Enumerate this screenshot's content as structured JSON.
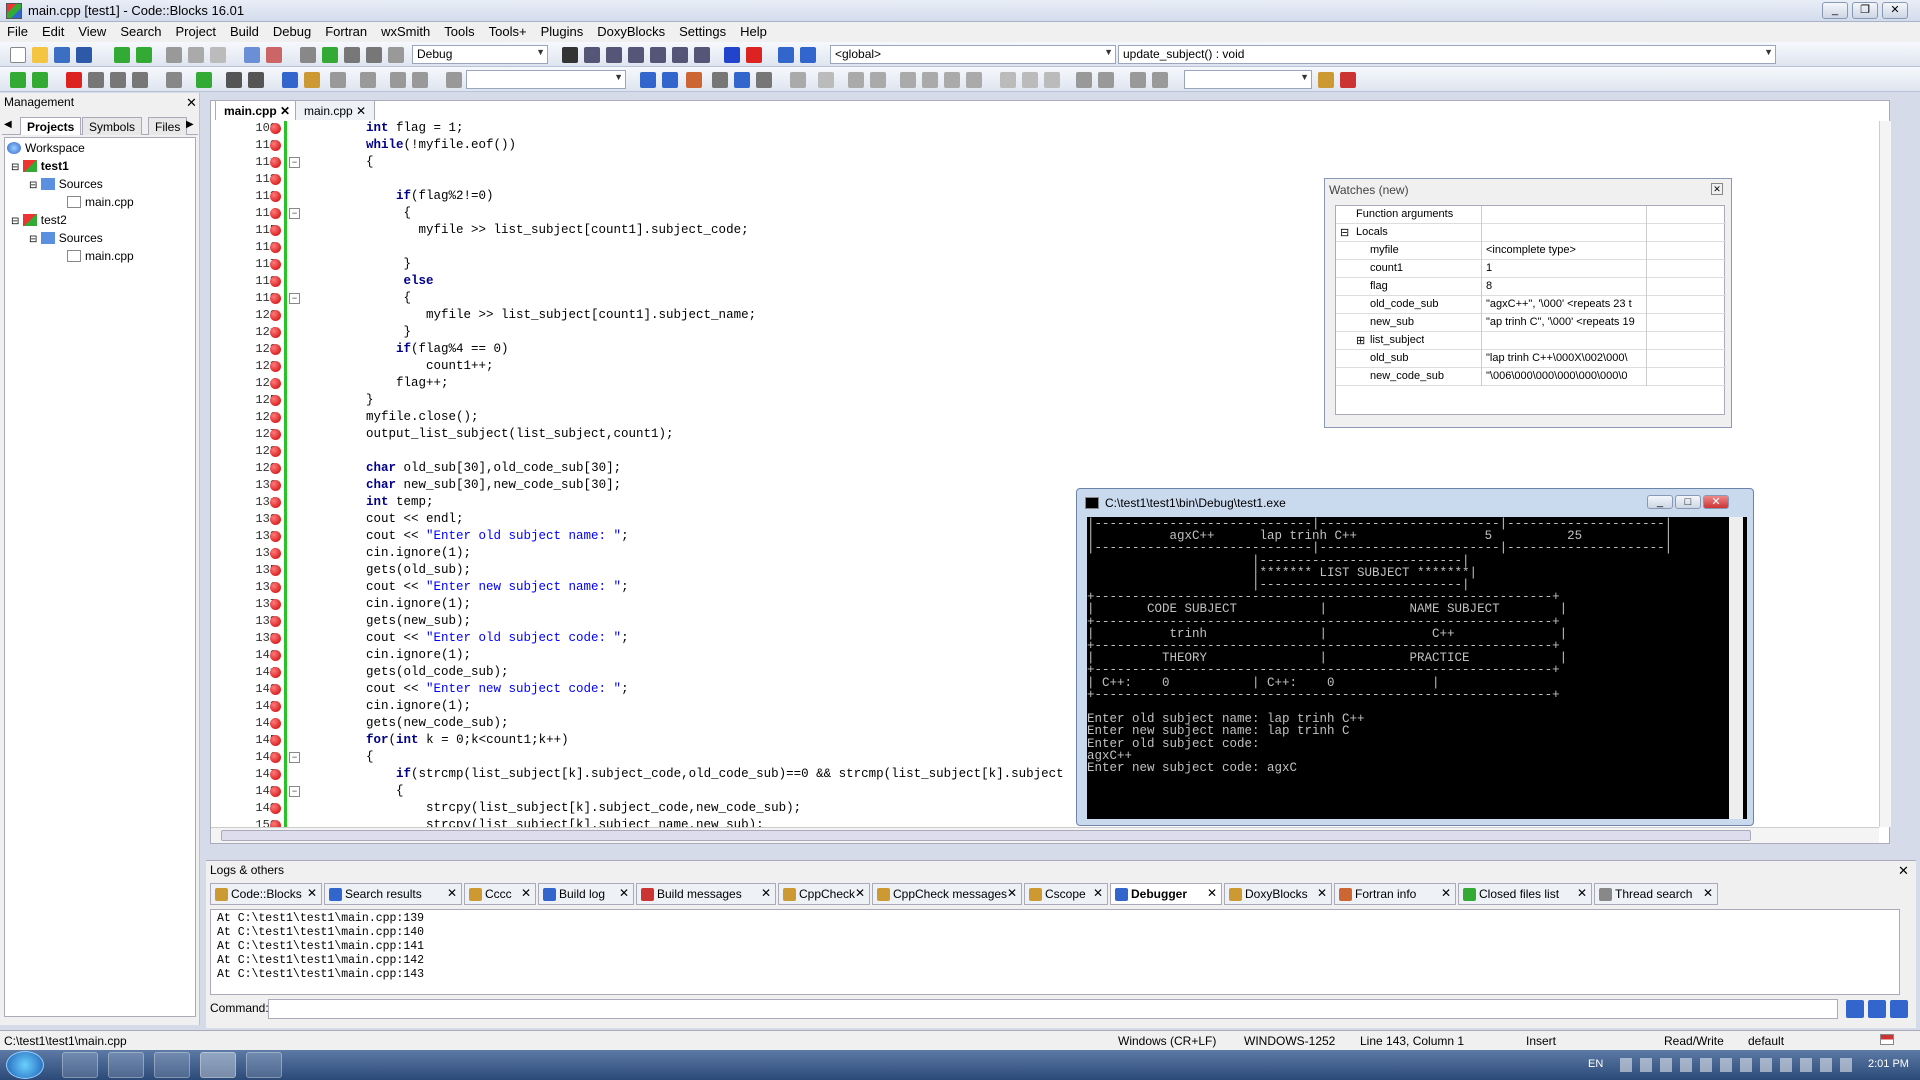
{
  "window": {
    "title": "main.cpp [test1] - Code::Blocks 16.01"
  },
  "menu": [
    "File",
    "Edit",
    "View",
    "Search",
    "Project",
    "Build",
    "Debug",
    "Fortran",
    "wxSmith",
    "Tools",
    "Tools+",
    "Plugins",
    "DoxyBlocks",
    "Settings",
    "Help"
  ],
  "toolbar": {
    "build_target": "Debug",
    "scope": "<global>",
    "function": "update_subject() : void"
  },
  "management": {
    "title": "Management",
    "tabs": [
      "Projects",
      "Symbols",
      "Files"
    ],
    "tree": {
      "workspace": "Workspace",
      "p1": "test1",
      "p1_sources": "Sources",
      "p1_file": "main.cpp",
      "p2": "test2",
      "p2_sources": "Sources",
      "p2_file": "main.cpp"
    }
  },
  "editor": {
    "tabs": [
      "main.cpp",
      "main.cpp"
    ]
  },
  "code": [
    {
      "n": "109",
      "t": "    int flag = 1;"
    },
    {
      "n": "110",
      "t": "    while(!myfile.eof())"
    },
    {
      "n": "111",
      "t": "    {"
    },
    {
      "n": "112",
      "t": ""
    },
    {
      "n": "113",
      "t": "        if(flag%2!=0)"
    },
    {
      "n": "114",
      "t": "         {"
    },
    {
      "n": "115",
      "t": "           myfile >> list_subject[count1].subject_code;"
    },
    {
      "n": "116",
      "t": ""
    },
    {
      "n": "117",
      "t": "         }"
    },
    {
      "n": "118",
      "t": "         else"
    },
    {
      "n": "119",
      "t": "         {"
    },
    {
      "n": "120",
      "t": "            myfile >> list_subject[count1].subject_name;"
    },
    {
      "n": "121",
      "t": "         }"
    },
    {
      "n": "122",
      "t": "        if(flag%4 == 0)"
    },
    {
      "n": "123",
      "t": "            count1++;"
    },
    {
      "n": "124",
      "t": "        flag++;"
    },
    {
      "n": "125",
      "t": "    }"
    },
    {
      "n": "126",
      "t": "    myfile.close();"
    },
    {
      "n": "127",
      "t": "    output_list_subject(list_subject,count1);"
    },
    {
      "n": "128",
      "t": ""
    },
    {
      "n": "129",
      "t": "    char old_sub[30],old_code_sub[30];"
    },
    {
      "n": "130",
      "t": "    char new_sub[30],new_code_sub[30];"
    },
    {
      "n": "131",
      "t": "    int temp;"
    },
    {
      "n": "132",
      "t": "    cout << endl;"
    },
    {
      "n": "133",
      "t": "    cout << \"Enter old subject name: \";"
    },
    {
      "n": "134",
      "t": "    cin.ignore(1);"
    },
    {
      "n": "135",
      "t": "    gets(old_sub);"
    },
    {
      "n": "136",
      "t": "    cout << \"Enter new subject name: \";"
    },
    {
      "n": "137",
      "t": "    cin.ignore(1);"
    },
    {
      "n": "138",
      "t": "    gets(new_sub);"
    },
    {
      "n": "139",
      "t": "    cout << \"Enter old subject code: \";"
    },
    {
      "n": "140",
      "t": "    cin.ignore(1);"
    },
    {
      "n": "141",
      "t": "    gets(old_code_sub);"
    },
    {
      "n": "142",
      "t": "    cout << \"Enter new subject code: \";"
    },
    {
      "n": "143",
      "t": "    cin.ignore(1);"
    },
    {
      "n": "144",
      "t": "    gets(new_code_sub);"
    },
    {
      "n": "145",
      "t": "    for(int k = 0;k<count1;k++)"
    },
    {
      "n": "146",
      "t": "    {"
    },
    {
      "n": "147",
      "t": "        if(strcmp(list_subject[k].subject_code,old_code_sub)==0 && strcmp(list_subject[k].subject"
    },
    {
      "n": "148",
      "t": "        {"
    },
    {
      "n": "149",
      "t": "            strcpy(list_subject[k].subject_code,new_code_sub);"
    },
    {
      "n": "150",
      "t": "            strcpy(list_subject[k].subject_name,new_sub);"
    }
  ],
  "watches": {
    "title": "Watches (new)",
    "rows": [
      {
        "name": "Function arguments",
        "value": ""
      },
      {
        "name": "Locals",
        "value": ""
      },
      {
        "name": "myfile",
        "value": "<incomplete type>"
      },
      {
        "name": "count1",
        "value": "1"
      },
      {
        "name": "flag",
        "value": "8"
      },
      {
        "name": "old_code_sub",
        "value": "\"agxC++\", '\\000' <repeats 23 t"
      },
      {
        "name": "new_sub",
        "value": "\"ap trinh C\", '\\000' <repeats 19"
      },
      {
        "name": "list_subject",
        "value": ""
      },
      {
        "name": "old_sub",
        "value": "\"lap trinh C++\\000X\\002\\000\\"
      },
      {
        "name": "new_code_sub",
        "value": "\"\\006\\000\\000\\000\\000\\000\\0"
      }
    ]
  },
  "console": {
    "title": "C:\\test1\\test1\\bin\\Debug\\test1.exe",
    "lines": [
      "|-----------------------------|------------------------|---------------------|",
      "|          agxC++      lap trinh C++                 5          25           |",
      "|-----------------------------|------------------------|---------------------|",
      "                      |---------------------------|",
      "                      |******* LIST SUBJECT *******|",
      "                      |---------------------------|",
      "+-------------------------------------------------------------+",
      "|       CODE SUBJECT           |           NAME SUBJECT        |",
      "+-------------------------------------------------------------+",
      "|          trinh               |              C++              |",
      "+-------------------------------------------------------------+",
      "|         THEORY               |           PRACTICE            |",
      "+-------------------------------------------------------------+",
      "| C++:    0           | C++:    0             |",
      "+-------------------------------------------------------------+",
      "",
      "Enter old subject name: lap trinh C++",
      "Enter new subject name: lap trinh C",
      "Enter old subject code:",
      "agxC++",
      "Enter new subject code: agxC"
    ]
  },
  "logs": {
    "title": "Logs & others",
    "tabs": [
      "Code::Blocks",
      "Search results",
      "Cccc",
      "Build log",
      "Build messages",
      "CppCheck",
      "CppCheck messages",
      "Cscope",
      "Debugger",
      "DoxyBlocks",
      "Fortran info",
      "Closed files list",
      "Thread search"
    ],
    "lines": [
      "At C:\\test1\\test1\\main.cpp:139",
      "At C:\\test1\\test1\\main.cpp:140",
      "At C:\\test1\\test1\\main.cpp:141",
      "At C:\\test1\\test1\\main.cpp:142",
      "At C:\\test1\\test1\\main.cpp:143"
    ],
    "command_label": "Command:"
  },
  "status": {
    "file": "C:\\test1\\test1\\main.cpp",
    "eol": "Windows (CR+LF)",
    "encoding": "WINDOWS-1252",
    "position": "Line 143, Column 1",
    "mode": "Insert",
    "access": "Read/Write",
    "lang": "default"
  },
  "taskbar": {
    "lang": "EN",
    "time": "2:01 PM"
  }
}
